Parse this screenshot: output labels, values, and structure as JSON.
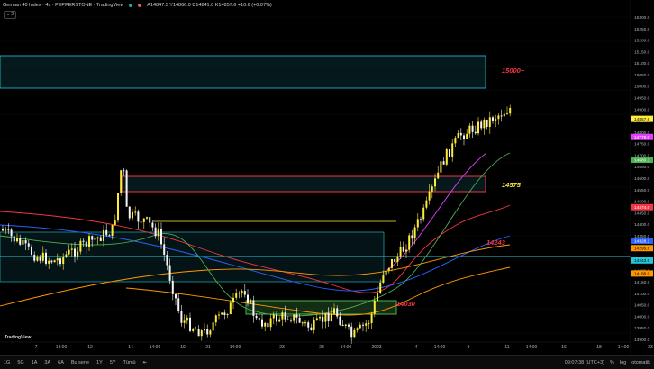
{
  "header": {
    "symbol": "German 40 Index · 4s · PEPPERSTONE · TradingView",
    "ohlc": "A14847.5  Y14866.0  D14841.0  K14857.6  +10.6 (+0.07%)",
    "collapse_label": "⌄ 2",
    "dot_colors": [
      "#26a69a",
      "#ef5350"
    ]
  },
  "annotations": [
    {
      "text": "15000~",
      "color": "#f23645"
    },
    {
      "text": "14575",
      "color": "#ffeb3b"
    },
    {
      "text": "14243",
      "color": "#f23645"
    },
    {
      "text": "14030",
      "color": "#f23645"
    }
  ],
  "price_scale": [
    "15300.0",
    "15250.0",
    "15200.0",
    "15150.0",
    "15100.0",
    "15050.0",
    "15000.0",
    "14950.0",
    "14900.0",
    "14850.0",
    "14800.0",
    "14750.0",
    "14700.0",
    "14650.0",
    "14600.0",
    "14550.0",
    "14500.0",
    "14450.0",
    "14400.0",
    "14350.0",
    "14300.0",
    "14250.0",
    "14200.0",
    "14150.0",
    "14100.0",
    "14050.0",
    "14000.0",
    "13950.0",
    "13900.0"
  ],
  "price_badges": [
    {
      "text": "14857.6",
      "sub": "32:21",
      "bg": "#ffeb3b",
      "fg": "#000",
      "price": 14857.6
    },
    {
      "text": "14779.0",
      "bg": "#e040fb",
      "fg": "#fff",
      "price": 14779
    },
    {
      "text": "14680.3",
      "bg": "#4caf50",
      "fg": "#fff",
      "price": 14680
    },
    {
      "text": "14474.0",
      "bg": "#f23645",
      "fg": "#fff",
      "price": 14474
    },
    {
      "text": "14328.1",
      "bg": "#2962ff",
      "fg": "#fff",
      "price": 14328
    },
    {
      "text": "14295.6",
      "bg": "#ff9800",
      "fg": "#000",
      "price": 14296
    },
    {
      "text": "14243.0",
      "bg": "#26c6da",
      "fg": "#000",
      "price": 14243
    },
    {
      "text": "14186.0",
      "bg": "#ff9800",
      "fg": "#000",
      "price": 14186
    }
  ],
  "time_scale": [
    "7",
    "14:00",
    "12",
    "14",
    "14:00",
    "19",
    "21",
    "14:00",
    "23",
    "28",
    "14:00",
    "2023",
    "4",
    "14:00",
    "9",
    "11",
    "14:00",
    "16",
    "18",
    "14:00",
    "23"
  ],
  "bottom_bar": {
    "timeframes": [
      "1G",
      "5G",
      "1A",
      "3A",
      "6A",
      "Bu sene",
      "1Y",
      "5Y",
      "Tümü"
    ],
    "clock": "09:07:38 (UTC+3)",
    "percent": "%",
    "log": "log",
    "auto": "otomatik"
  },
  "logo_text": "TradingView",
  "colors": {
    "bull": "#ffeb3b",
    "bear": "#f5f5f5",
    "zone_cyan": "#26c6da",
    "zone_red": "#f23645",
    "zone_green": "#4caf50"
  }
}
